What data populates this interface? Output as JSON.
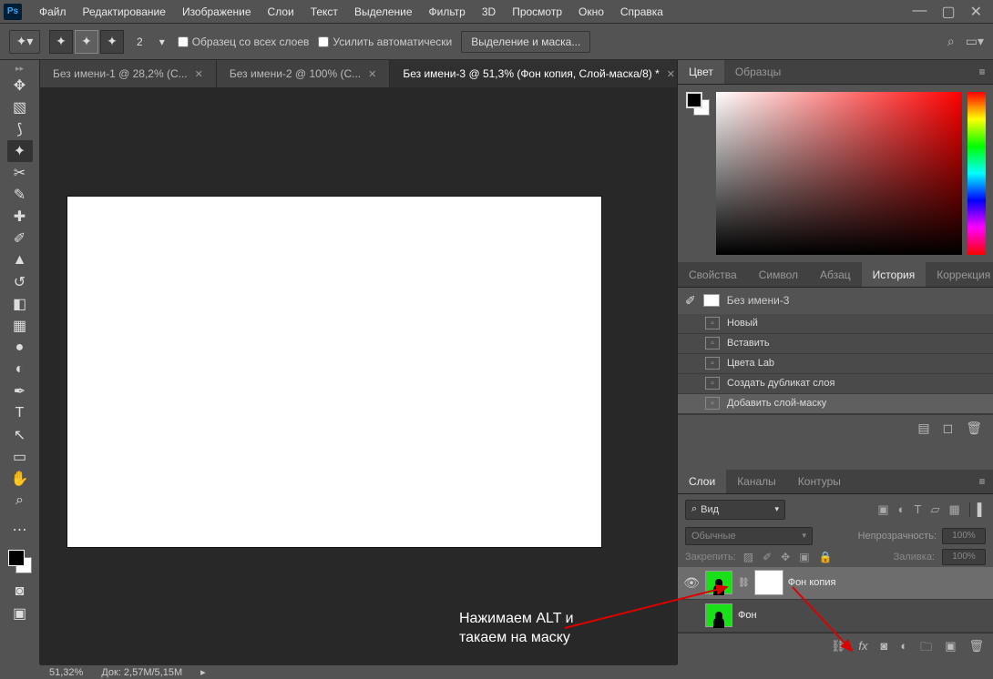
{
  "menubar": {
    "items": [
      "Файл",
      "Редактирование",
      "Изображение",
      "Слои",
      "Текст",
      "Выделение",
      "Фильтр",
      "3D",
      "Просмотр",
      "Окно",
      "Справка"
    ]
  },
  "optbar": {
    "size_value": "2",
    "check1": "Образец со всех слоев",
    "check2": "Усилить автоматически",
    "refine_btn": "Выделение и маска..."
  },
  "tabs": [
    {
      "label": "Без имени-1 @ 28,2% (C...",
      "active": false
    },
    {
      "label": "Без имени-2 @ 100% (C...",
      "active": false
    },
    {
      "label": "Без имени-3 @ 51,3% (Фон копия, Слой-маска/8) *",
      "active": true
    }
  ],
  "tools": [
    "↔",
    "▧",
    "⊹",
    "✦",
    "✂",
    "✎",
    "⌁",
    "⁂",
    "✐",
    "▃",
    "⟳",
    "⟋",
    "◌",
    "✎",
    "●",
    "⤾",
    "✍",
    "▭",
    "T",
    "↖",
    "▢",
    "✋",
    "⌕"
  ],
  "panels": {
    "color_tabs": [
      "Цвет",
      "Образцы"
    ],
    "color_active": 0,
    "mid_tabs": [
      "Свойства",
      "Символ",
      "Абзац",
      "История",
      "Коррекция"
    ],
    "mid_active": 3,
    "history_doc": "Без имени-3",
    "history": [
      "Новый",
      "Вставить",
      "Цвета Lab",
      "Создать дубликат слоя",
      "Добавить слой-маску"
    ],
    "history_active": 4,
    "layers_tabs": [
      "Слои",
      "Каналы",
      "Контуры"
    ],
    "layers_active": 0,
    "layers_kind": "Вид",
    "blend_mode": "Обычные",
    "opacity_label": "Непрозрачность:",
    "opacity_value": "100%",
    "lock_label": "Закрепить:",
    "fill_label": "Заливка:",
    "fill_value": "100%",
    "layers": [
      {
        "name": "Фон копия",
        "selected": true,
        "has_mask": true,
        "eye": true
      },
      {
        "name": "Фон",
        "selected": false,
        "has_mask": false,
        "eye": false
      }
    ]
  },
  "status": {
    "zoom": "51,32%",
    "doc": "Док: 2,57M/5,15M"
  },
  "annotation": {
    "line1": "Нажимаем ALT и",
    "line2": "такаем на маску"
  }
}
